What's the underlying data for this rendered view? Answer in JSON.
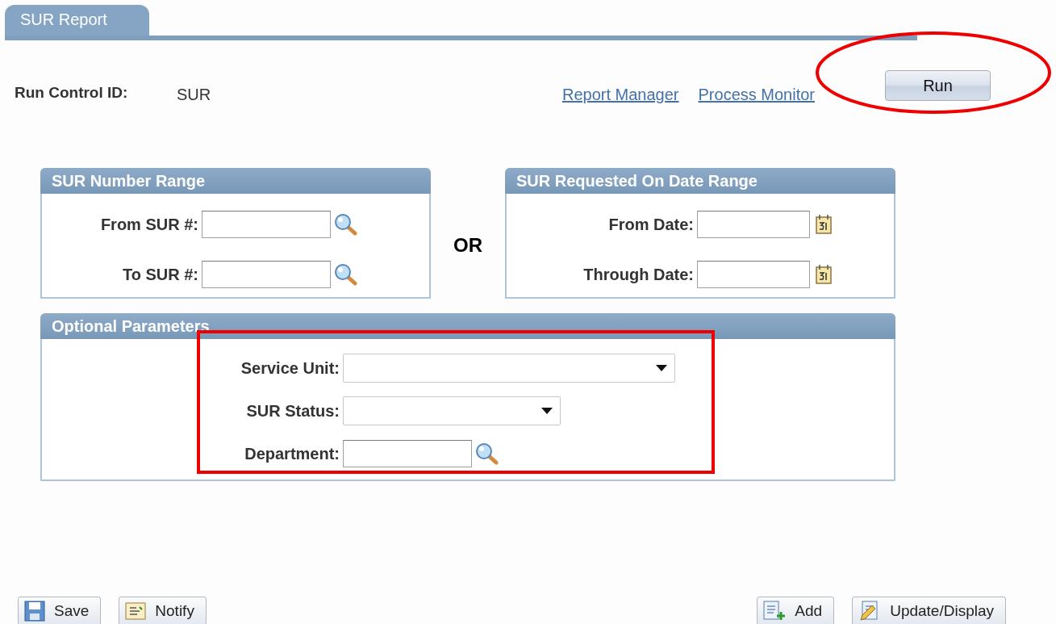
{
  "tab": {
    "label": "SUR Report",
    "selected": true
  },
  "run_control": {
    "label": "Run Control ID:",
    "value": "SUR"
  },
  "links": [
    "Report Manager",
    "Process Monitor"
  ],
  "run_button": "Run",
  "range_panels": [
    {
      "title": "SUR Number Range",
      "fields": [
        {
          "label": "From SUR #:",
          "kind": "lookup"
        },
        {
          "label": "To SUR #:",
          "kind": "lookup"
        }
      ]
    },
    {
      "title": "SUR Requested On Date Range",
      "fields": [
        {
          "label": "From Date:",
          "kind": "date"
        },
        {
          "label": "Through Date:",
          "kind": "date"
        }
      ]
    }
  ],
  "separator": "OR",
  "optional": {
    "title": "Optional Parameters",
    "fields": [
      {
        "label": "Service Unit:",
        "kind": "long_select"
      },
      {
        "label": "SUR Status:",
        "kind": "short_select"
      },
      {
        "label": "Department:",
        "kind": "lookup"
      }
    ]
  },
  "footer": {
    "left": [
      {
        "label": "Save",
        "kind": "save"
      },
      {
        "label": "Notify",
        "kind": "notify"
      }
    ],
    "right": [
      {
        "label": "Add",
        "kind": "add"
      },
      {
        "label": "Update/Display",
        "kind": "update"
      }
    ]
  }
}
